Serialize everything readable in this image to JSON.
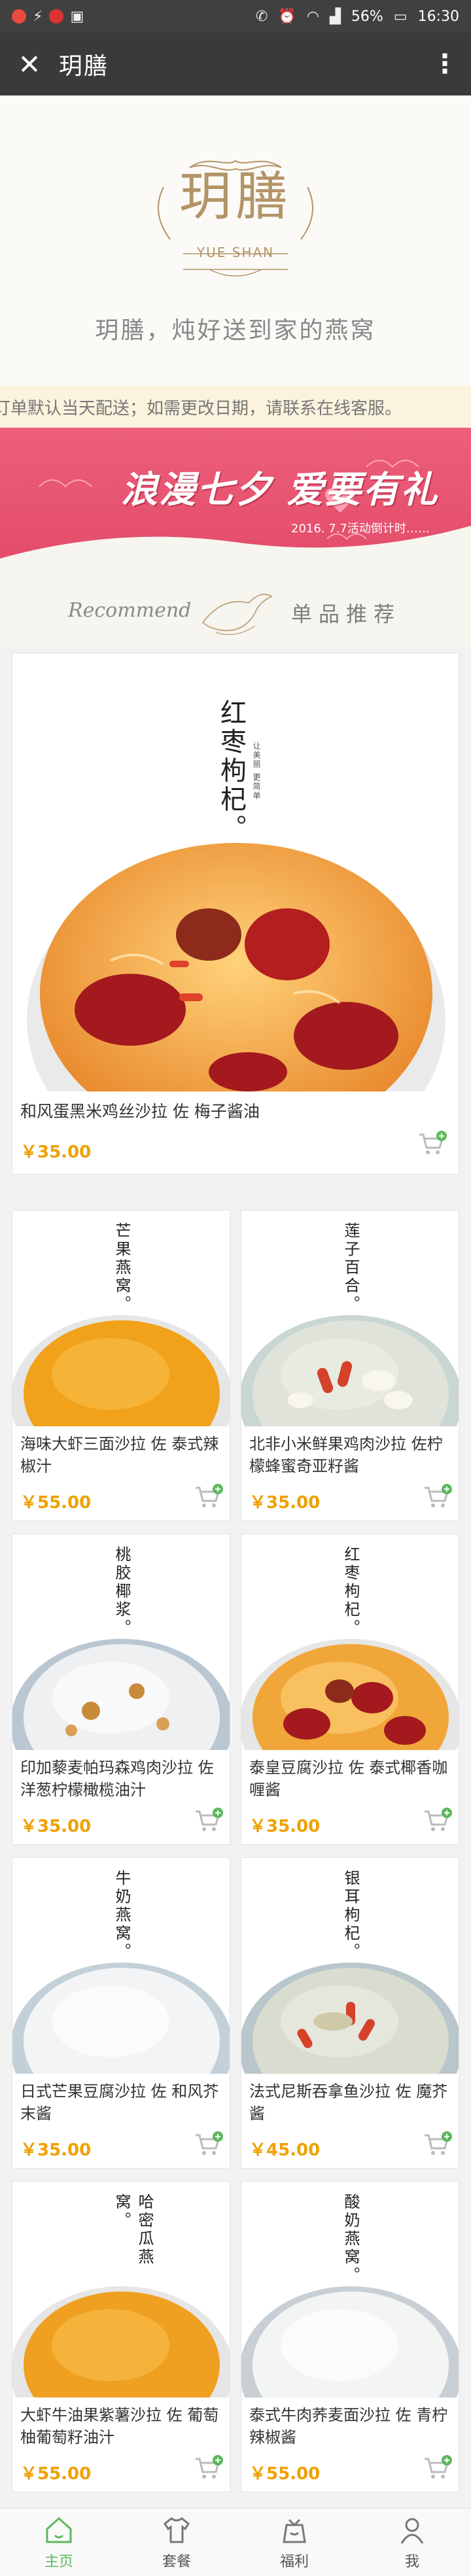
{
  "status_bar": {
    "battery": "56%",
    "time": "16:30"
  },
  "toolbar": {
    "title": "玥膳",
    "close_icon": "close-icon",
    "more_icon": "more-vertical-icon"
  },
  "brand": {
    "logo_text": "玥膳",
    "logo_en": "YUE SHAN",
    "tagline": "玥膳，炖好送到家的燕窝",
    "gold": "#b39467"
  },
  "notice": {
    "text": "订单默认当天配送；如需更改日期，请联系在线客服。"
  },
  "banner": {
    "title": "浪漫七夕 爱要有礼",
    "subtitle": "2016. 7.7活动倒计时……",
    "color": "#e85873"
  },
  "recommend": {
    "en": "Recommend",
    "cn": "单品推荐"
  },
  "featured": {
    "image_title": "红枣枸杞。",
    "image_note": "让美丽 更简单",
    "name": "和风蛋黑米鸡丝沙拉 佐 梅子酱油",
    "price": "￥35.00"
  },
  "products": [
    {
      "image_title": "芒果燕窝。",
      "name": "海味大虾三面沙拉 佐 泰式辣椒汁",
      "price": "￥55.00",
      "bowl": "mango"
    },
    {
      "image_title": "莲子百合。",
      "name": "北非小米鲜果鸡肉沙拉 佐柠檬蜂蜜奇亚籽酱",
      "price": "￥35.00",
      "bowl": "lotus"
    },
    {
      "image_title": "桃胶椰浆。",
      "name": "印加藜麦帕玛森鸡肉沙拉 佐洋葱柠檬橄榄油汁",
      "price": "￥35.00",
      "bowl": "coconut"
    },
    {
      "image_title": "红枣枸杞。",
      "name": "泰皇豆腐沙拉 佐 泰式椰香咖喱酱",
      "price": "￥35.00",
      "bowl": "dates"
    },
    {
      "image_title": "牛奶燕窝。",
      "name": "日式芒果豆腐沙拉 佐 和风芥末酱",
      "price": "￥35.00",
      "bowl": "milk"
    },
    {
      "image_title": "银耳枸杞。",
      "name": "法式尼斯吞拿鱼沙拉 佐 魔芥酱",
      "price": "￥45.00",
      "bowl": "silver"
    },
    {
      "image_title": "哈密瓜燕窝。",
      "name": "大虾牛油果紫薯沙拉 佐 葡萄柚葡萄籽油汁",
      "price": "￥55.00",
      "bowl": "melon"
    },
    {
      "image_title": "酸奶燕窝。",
      "name": "泰式牛肉荞麦面沙拉 佐 青柠辣椒酱",
      "price": "￥55.00",
      "bowl": "yogurt"
    }
  ],
  "nav": [
    {
      "label": "主页",
      "icon": "home-icon",
      "active": true
    },
    {
      "label": "套餐",
      "icon": "shirt-icon",
      "active": false
    },
    {
      "label": "福利",
      "icon": "gift-bag-icon",
      "active": false
    },
    {
      "label": "我",
      "icon": "user-icon",
      "active": false
    }
  ],
  "colors": {
    "price": "#f0a000",
    "accent_green": "#5cb85c"
  }
}
